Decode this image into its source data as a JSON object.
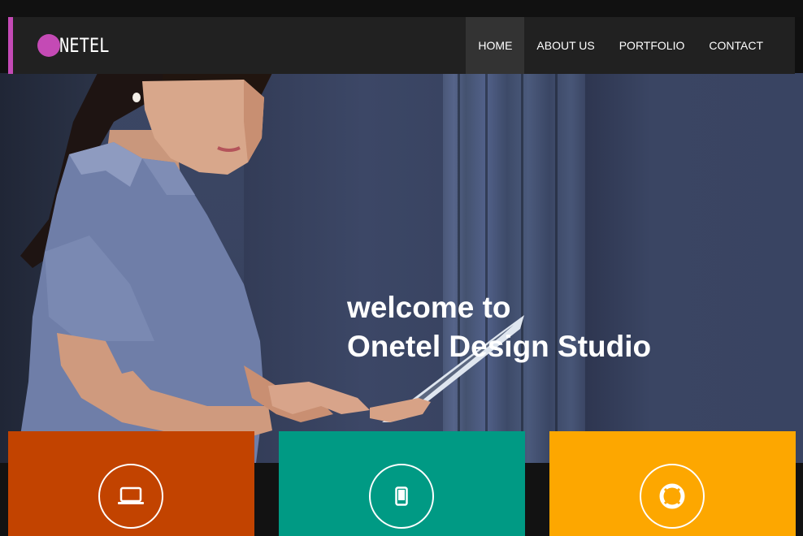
{
  "brand": {
    "logo_letter_color": "#c44ab5",
    "logo_text": "NETEL"
  },
  "nav": {
    "items": [
      {
        "label": "HOME",
        "active": true
      },
      {
        "label": "ABOUT US",
        "active": false
      },
      {
        "label": "PORTFOLIO",
        "active": false
      },
      {
        "label": "CONTACT",
        "active": false
      }
    ]
  },
  "hero": {
    "title_line1": "welcome to",
    "title_line2": "Onetel Design Studio"
  },
  "features": [
    {
      "icon": "laptop-icon",
      "color": "#c24300"
    },
    {
      "icon": "mobile-icon",
      "color": "#009a84"
    },
    {
      "icon": "lifebuoy-icon",
      "color": "#fda700"
    }
  ],
  "colors": {
    "accent": "#c44ab5",
    "nav_bg": "#212121",
    "nav_active": "#333333"
  }
}
